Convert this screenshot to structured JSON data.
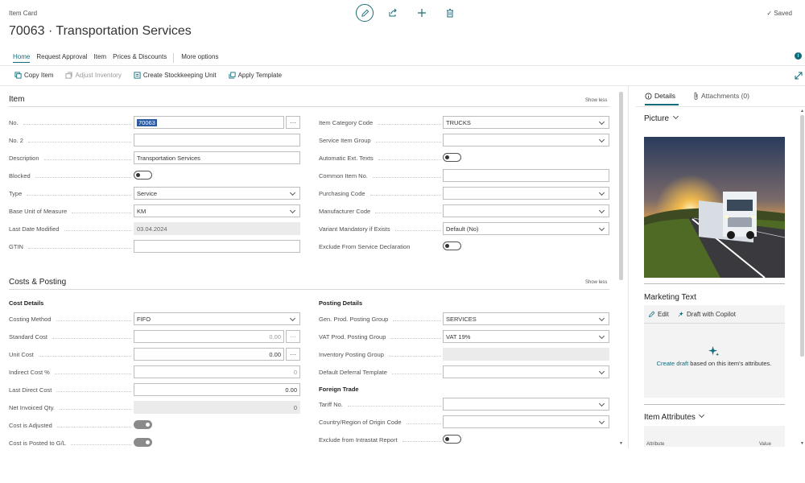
{
  "header": {
    "page_type": "Item Card",
    "title": "70063 · Transportation Services",
    "saved": "Saved"
  },
  "nav": {
    "tabs": [
      "Home",
      "Request Approval",
      "Item",
      "Prices & Discounts"
    ],
    "more": "More options"
  },
  "toolbar": {
    "copy_item": "Copy Item",
    "adjust_inventory": "Adjust Inventory",
    "create_sku": "Create Stockkeeping Unit",
    "apply_template": "Apply Template"
  },
  "item_section": {
    "title": "Item",
    "show_less": "Show less",
    "left": {
      "no_label": "No.",
      "no_value": "70063",
      "no2_label": "No. 2",
      "no2_value": "",
      "description_label": "Description",
      "description_value": "Transportation Services",
      "blocked_label": "Blocked",
      "type_label": "Type",
      "type_value": "Service",
      "base_uom_label": "Base Unit of Measure",
      "base_uom_value": "KM",
      "last_modified_label": "Last Date Modified",
      "last_modified_value": "03.04.2024",
      "gtin_label": "GTIN",
      "gtin_value": ""
    },
    "right": {
      "category_label": "Item Category Code",
      "category_value": "TRUCKS",
      "service_group_label": "Service Item Group",
      "service_group_value": "",
      "auto_ext_label": "Automatic Ext. Texts",
      "common_no_label": "Common Item No.",
      "common_no_value": "",
      "purchasing_label": "Purchasing Code",
      "purchasing_value": "",
      "manufacturer_label": "Manufacturer Code",
      "manufacturer_value": "",
      "variant_label": "Variant Mandatory if Exists",
      "variant_value": "Default (No)",
      "exclude_label": "Exclude From Service Declaration"
    }
  },
  "costs_section": {
    "title": "Costs & Posting",
    "show_less": "Show less",
    "cost_details": "Cost Details",
    "posting_details": "Posting Details",
    "foreign_trade": "Foreign Trade",
    "left": {
      "costing_method_label": "Costing Method",
      "costing_method_value": "FIFO",
      "standard_cost_label": "Standard Cost",
      "standard_cost_value": "0.00",
      "unit_cost_label": "Unit Cost",
      "unit_cost_value": "0.00",
      "indirect_cost_label": "Indirect Cost %",
      "indirect_cost_value": "0",
      "last_direct_cost_label": "Last Direct Cost",
      "last_direct_cost_value": "0.00",
      "net_invoiced_label": "Net Invoiced Qty.",
      "net_invoiced_value": "0",
      "cost_adjusted_label": "Cost is Adjusted",
      "cost_posted_label": "Cost is Posted to G/L"
    },
    "right": {
      "gen_prod_label": "Gen. Prod. Posting Group",
      "gen_prod_value": "SERVICES",
      "vat_prod_label": "VAT Prod. Posting Group",
      "vat_prod_value": "VAT 19%",
      "inv_posting_label": "Inventory Posting Group",
      "inv_posting_value": "",
      "deferral_label": "Default Deferral Template",
      "deferral_value": "",
      "tariff_label": "Tariff No.",
      "tariff_value": "",
      "country_label": "Country/Region of Origin Code",
      "country_value": "",
      "intrastat_label": "Exclude from Intrastat Report"
    }
  },
  "factbox": {
    "details_tab": "Details",
    "attachments_tab": "Attachments (0)",
    "picture_title": "Picture",
    "marketing_title": "Marketing Text",
    "edit_label": "Edit",
    "draft_copilot_label": "Draft with Copilot",
    "create_draft_link": "Create draft",
    "create_draft_rest": " based on this item's attributes.",
    "item_attributes_title": "Item Attributes",
    "attr_col": "Attribute",
    "value_col": "Value"
  },
  "colors": {
    "accent": "#106b7a",
    "selection": "#2c5aa0",
    "readonly_bg": "#ebebeb"
  }
}
